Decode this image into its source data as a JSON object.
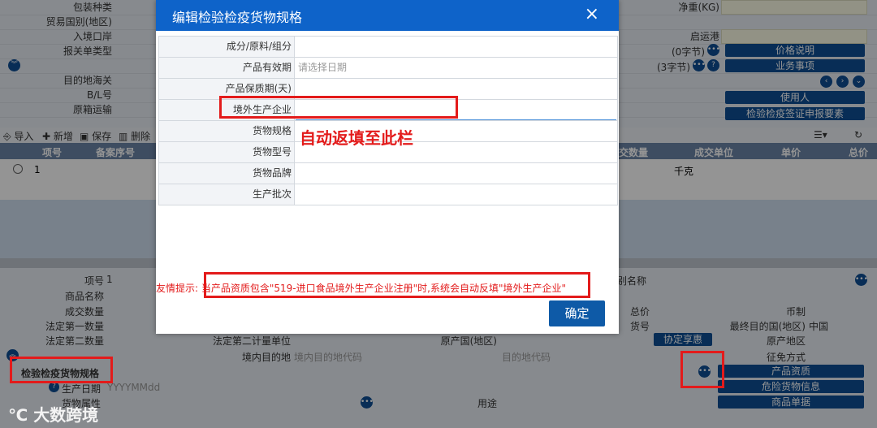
{
  "background": {
    "labels_left": [
      "包装种类",
      "贸易国别(地区)",
      "入境口岸",
      "报关单类型",
      "",
      "目的地海关",
      "B/L号",
      "原箱运输"
    ],
    "labels_right_top": [
      "净重(KG)",
      "启运港"
    ],
    "count_0": "(0字节)",
    "count_3": "(3字节)",
    "btn_price": "价格说明",
    "btn_business": "业务事项",
    "btn_user": "使用人",
    "btn_cert": "检验检疫签证申报要素",
    "toolbar": {
      "import": "导入",
      "add": "新增",
      "save": "保存",
      "delete": "删除"
    },
    "grid_headers": {
      "item_no": "项号",
      "record_no": "备案序号",
      "qty": "交数量",
      "unit": "成交单位",
      "price": "单价",
      "total": "总价"
    },
    "grid_row": {
      "no": "1",
      "unit": "千克"
    },
    "lower_labels": {
      "item_no": "项号",
      "item_no_val": "1",
      "goods_name": "商品名称",
      "trade_qty": "成交数量",
      "legal_qty1": "法定第一数量",
      "legal_qty2": "法定第二数量",
      "legal_unit2": "法定第二计量单位",
      "origin": "原产国(地区)",
      "dest_area": "境内目的地",
      "spec_label": "检验检疫货物规格",
      "prod_date": "生产日期",
      "goods_attr": "货物属性",
      "usage": "用途",
      "total_price": "总价",
      "currency": "币制",
      "goods_no": "货号",
      "final_dest": "最终目的国(地区)",
      "final_dest_val": "中国",
      "origin_area": "原产地区",
      "exempt": "征免方式",
      "special_name": "别名称"
    },
    "placeholders": {
      "dest_code": "境内目的地代码",
      "dest_area_code": "目的地代码",
      "date": "YYYYMMdd"
    },
    "btn_agreement": "协定享惠",
    "btn_qualification": "产品资质",
    "btn_danger": "危险货物信息",
    "btn_docs": "商品单据"
  },
  "dialog": {
    "title": "编辑检验检疫货物规格",
    "close_icon": "×",
    "fields": [
      {
        "label": "成分/原料/组分",
        "value": ""
      },
      {
        "label": "产品有效期",
        "value": "请选择日期"
      },
      {
        "label": "产品保质期(天)",
        "value": ""
      },
      {
        "label": "境外生产企业",
        "value": ""
      },
      {
        "label": "货物规格",
        "value": ""
      },
      {
        "label": "货物型号",
        "value": ""
      },
      {
        "label": "货物品牌",
        "value": ""
      },
      {
        "label": "生产批次",
        "value": ""
      }
    ],
    "annotation": "自动返填至此栏",
    "tip": "友情提示: 当产品资质包含\"519-进口食品境外生产企业注册\"时,系统会自动反填\"境外生产企业\"",
    "ok_button": "确定"
  },
  "watermark": "大数跨境"
}
